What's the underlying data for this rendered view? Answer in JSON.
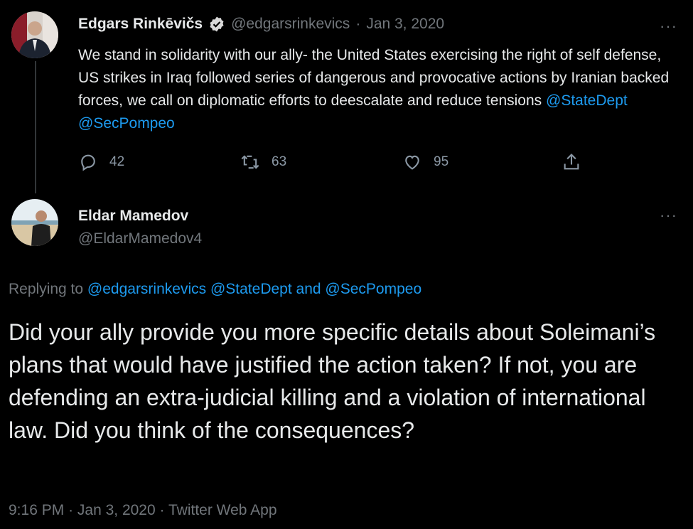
{
  "tweet1": {
    "author_name": "Edgars Rinkēvičs",
    "handle": "@edgarsrinkevics",
    "separator": "·",
    "date": "Jan 3, 2020",
    "verified": true,
    "text_main": "We stand in solidarity with our ally- the United States exercising the right of self defense, US strikes in Iraq followed series of dangerous and provocative actions by Iranian backed forces, we call on diplomatic efforts to deescalate and reduce tensions",
    "mention1": "@StateDept",
    "mention2": "@SecPompeo",
    "replies": "42",
    "retweets": "63",
    "likes": "95",
    "more": "···"
  },
  "tweet2": {
    "author_name": "Eldar Mamedov",
    "handle": "@EldarMamedov4",
    "more": "···",
    "replying_prefix": "Replying to",
    "replying_mention1": "@edgarsrinkevics",
    "replying_mention2": "@StateDept",
    "replying_and": "and",
    "replying_mention3": "@SecPompeo",
    "text": "Did your ally provide you more specific details about Soleimani’s plans that would have justified the action taken? If not, you are defending an extra-judicial killing and a violation of international law. Did you think of the consequences?",
    "time": "9:16 PM",
    "separator": "·",
    "date": "Jan 3, 2020",
    "source": "Twitter Web App"
  },
  "colors": {
    "background": "#000000",
    "text": "#e7e9ea",
    "muted": "#71767b",
    "link": "#1d9bf0",
    "verified": "#d9d9d9"
  },
  "icons": [
    "reply-icon",
    "retweet-icon",
    "like-icon",
    "share-icon",
    "verified-badge-icon",
    "more-icon"
  ]
}
